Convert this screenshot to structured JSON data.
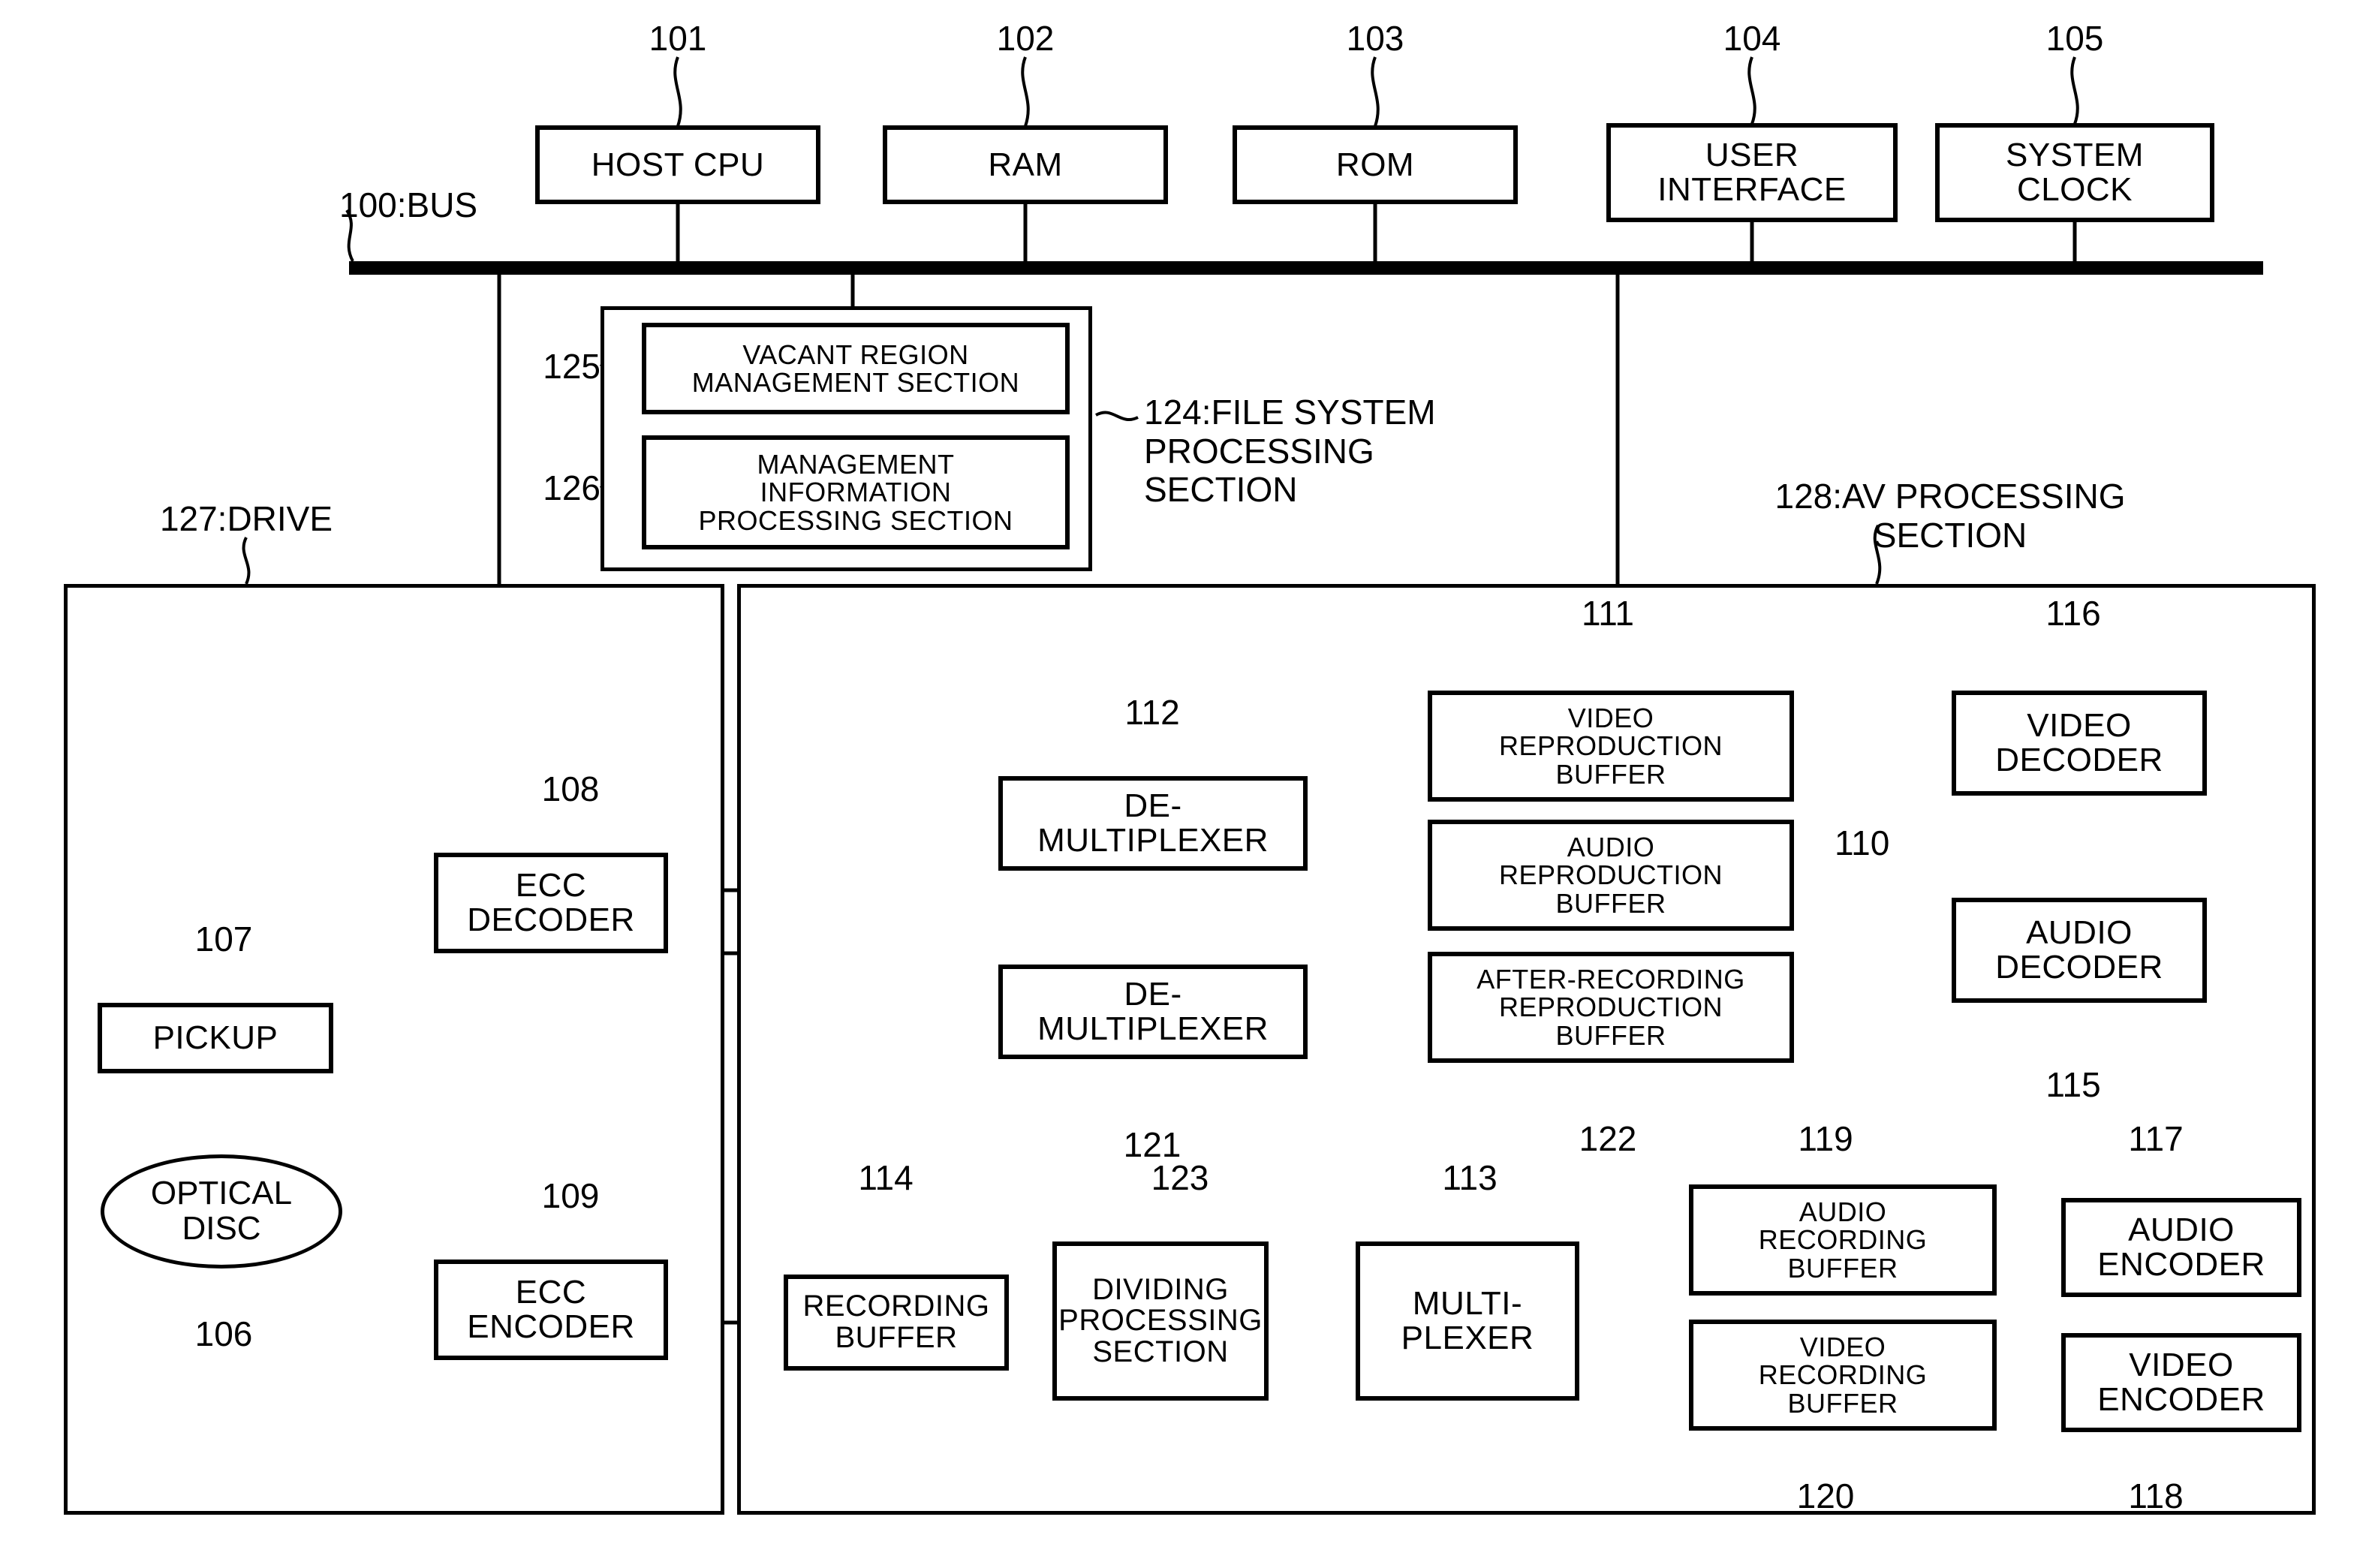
{
  "figure": {
    "type": "patent-block-diagram",
    "title": "Optical disc recording/reproducing apparatus block diagram"
  },
  "bus": {
    "label": "100:BUS"
  },
  "top_units": [
    {
      "ref": "101",
      "label": "HOST CPU"
    },
    {
      "ref": "102",
      "label": "RAM"
    },
    {
      "ref": "103",
      "label": "ROM"
    },
    {
      "ref": "104",
      "label": "USER\nINTERFACE"
    },
    {
      "ref": "105",
      "label": "SYSTEM\nCLOCK"
    }
  ],
  "file_system": {
    "label": "124:FILE SYSTEM\nPROCESSING\nSECTION",
    "ref": "124",
    "children": [
      {
        "ref": "125",
        "label": "VACANT REGION\nMANAGEMENT SECTION"
      },
      {
        "ref": "126",
        "label": "MANAGEMENT\nINFORMATION\nPROCESSING SECTION"
      }
    ]
  },
  "drive": {
    "label": "127:DRIVE",
    "ref": "127",
    "blocks": [
      {
        "ref": "106",
        "label": "OPTICAL\nDISC",
        "shape": "ellipse"
      },
      {
        "ref": "107",
        "label": "PICKUP"
      },
      {
        "ref": "108",
        "label": "ECC\nDECODER"
      },
      {
        "ref": "109",
        "label": "ECC\nENCODER"
      }
    ]
  },
  "av_section": {
    "label": "128:AV PROCESSING\nSECTION",
    "ref": "128",
    "blocks": [
      {
        "ref": "112",
        "label": "DE-\nMULTIPLEXER"
      },
      {
        "ref": "121",
        "label": "DE-\nMULTIPLEXER"
      },
      {
        "ref": "111",
        "label": "VIDEO\nREPRODUCTION\nBUFFER"
      },
      {
        "ref": "110",
        "label": "AUDIO\nREPRODUCTION\nBUFFER"
      },
      {
        "ref": "122",
        "label": "AFTER-RECORDING\nREPRODUCTION\nBUFFER"
      },
      {
        "ref": "116",
        "label": "VIDEO\nDECODER"
      },
      {
        "ref": "115",
        "label": "AUDIO\nDECODER"
      },
      {
        "ref": "114",
        "label": "RECORDING\nBUFFER"
      },
      {
        "ref": "123",
        "label": "DIVIDING\nPROCESSING\nSECTION"
      },
      {
        "ref": "113",
        "label": "MULTI-\nPLEXER"
      },
      {
        "ref": "119",
        "label": "AUDIO\nRECORDING\nBUFFER"
      },
      {
        "ref": "120",
        "label": "VIDEO\nRECORDING\nBUFFER"
      },
      {
        "ref": "117",
        "label": "AUDIO\nENCODER"
      },
      {
        "ref": "118",
        "label": "VIDEO\nENCODER"
      }
    ]
  },
  "refs": {
    "r100": "100:BUS",
    "r101": "101",
    "r102": "102",
    "r103": "103",
    "r104": "104",
    "r105": "105",
    "r106": "106",
    "r107": "107",
    "r108": "108",
    "r109": "109",
    "r110": "110",
    "r111": "111",
    "r112": "112",
    "r113": "113",
    "r114": "114",
    "r115": "115",
    "r116": "116",
    "r117": "117",
    "r118": "118",
    "r119": "119",
    "r120": "120",
    "r121": "121",
    "r122": "122",
    "r123": "123",
    "r124": "124:FILE SYSTEM\nPROCESSING\nSECTION",
    "r125": "125",
    "r126": "126",
    "r127": "127:DRIVE",
    "r128": "128:AV PROCESSING\nSECTION"
  },
  "labels": {
    "host_cpu": "HOST CPU",
    "ram": "RAM",
    "rom": "ROM",
    "user_interface": "USER\nINTERFACE",
    "system_clock": "SYSTEM\nCLOCK",
    "vacant_region": "VACANT REGION\nMANAGEMENT SECTION",
    "mgmt_info": "MANAGEMENT\nINFORMATION\nPROCESSING SECTION",
    "pickup": "PICKUP",
    "optical_disc": "OPTICAL\nDISC",
    "ecc_decoder": "ECC\nDECODER",
    "ecc_encoder": "ECC\nENCODER",
    "demux_top": "DE-\nMULTIPLEXER",
    "demux_bottom": "DE-\nMULTIPLEXER",
    "video_repro_buffer": "VIDEO\nREPRODUCTION\nBUFFER",
    "audio_repro_buffer": "AUDIO\nREPRODUCTION\nBUFFER",
    "after_rec_buffer": "AFTER-RECORDING\nREPRODUCTION\nBUFFER",
    "video_decoder": "VIDEO\nDECODER",
    "audio_decoder": "AUDIO\nDECODER",
    "recording_buffer": "RECORDING\nBUFFER",
    "dividing_section": "DIVIDING\nPROCESSING\nSECTION",
    "multiplexer": "MULTI-\nPLEXER",
    "audio_rec_buffer": "AUDIO\nRECORDING\nBUFFER",
    "video_rec_buffer": "VIDEO\nRECORDING\nBUFFER",
    "audio_encoder": "AUDIO\nENCODER",
    "video_encoder": "VIDEO\nENCODER"
  },
  "colors": {
    "ink": "#000000",
    "paper": "#ffffff"
  }
}
